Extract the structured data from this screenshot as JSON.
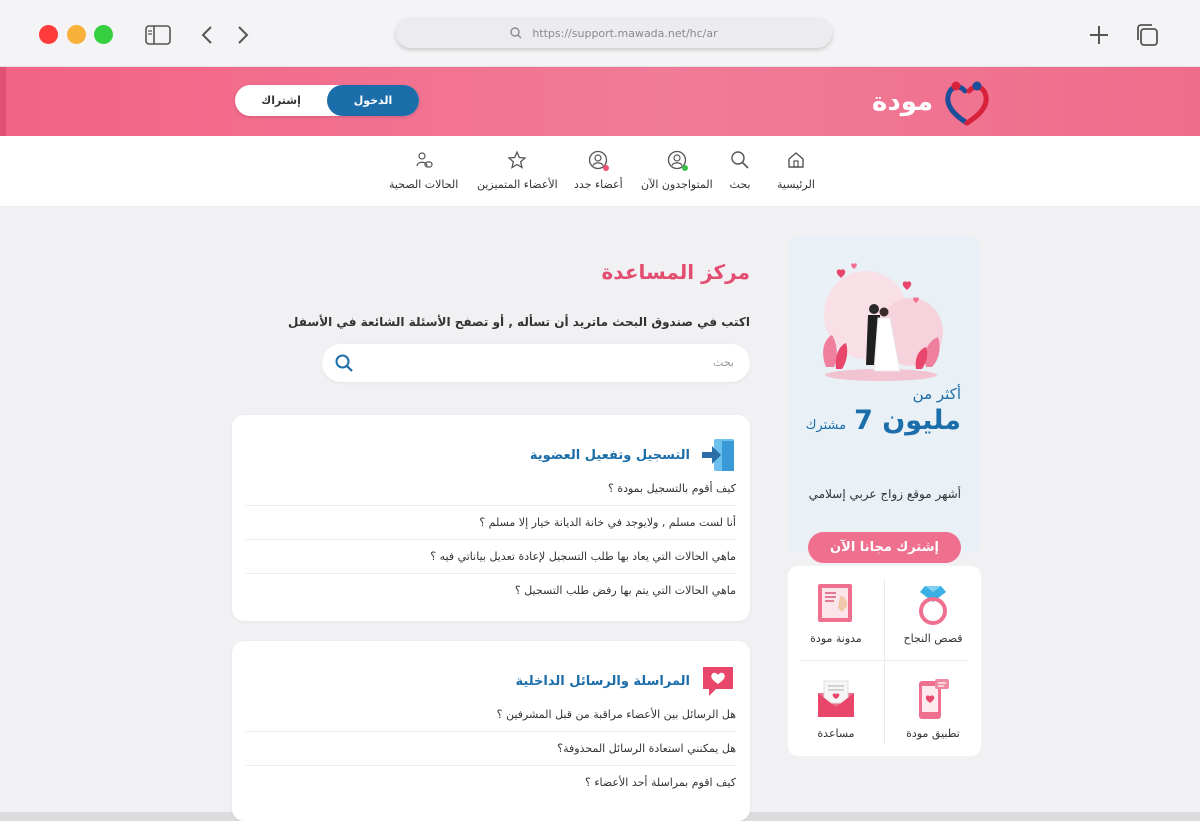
{
  "browser": {
    "url": "https://support.mawada.net/hc/ar"
  },
  "header": {
    "logo_text": "مودة",
    "login_label": "الدخول",
    "subscribe_label": "إشتراك"
  },
  "nav": {
    "items": [
      {
        "label": "الرئيسية",
        "icon": "home-icon"
      },
      {
        "label": "بحث",
        "icon": "search-icon"
      },
      {
        "label": "المتواجدون الآن",
        "icon": "user-online-icon"
      },
      {
        "label": "أعضاء جدد",
        "icon": "user-new-icon"
      },
      {
        "label": "الأعضاء المتميزين",
        "icon": "star-icon"
      },
      {
        "label": "الحالات الصحية",
        "icon": "health-icon"
      }
    ]
  },
  "main": {
    "title": "مركز المساعدة",
    "subtitle": "اكتب في صندوق البحث ماتريد أن تسأله , أو تصفح الأسئلة الشائعة في الأسفل",
    "search_placeholder": "بحث",
    "sections": [
      {
        "title": "التسجيل وتفعيل العضوية",
        "questions": [
          "كيف أقوم بالتسجيل بمودة ؟",
          "أنا لست مسلم , ولايوجد في خانة الديانة خيار إلا مسلم ؟",
          "ماهي الحالات التي يعاد بها طلب التسجيل لإعادة تعديل بياناتي فيه ؟",
          "ماهي الحالات التي يتم بها رفض طلب التسجيل ؟"
        ]
      },
      {
        "title": "المراسلة والرسائل الداخلية",
        "questions": [
          "هل الرسائل بين الأعضاء مراقبة من قبل المشرفين ؟",
          "هل يمكنني استعادة الرسائل المحذوفة؟",
          "كيف اقوم بمراسلة أحد الأعضاء ؟"
        ]
      }
    ]
  },
  "sidebar": {
    "promo": {
      "more_than": "أكثر من",
      "million": "7 مليون",
      "subscriber": "مشترك",
      "description": "أشهر موقع زواج عربي إسلامي",
      "cta": "إشترك مجانا الآن"
    },
    "links": [
      {
        "label": "قصص النجاح",
        "icon": "ring-icon"
      },
      {
        "label": "مدونة مودة",
        "icon": "blog-icon"
      },
      {
        "label": "تطبيق مودة",
        "icon": "phone-app-icon"
      },
      {
        "label": "مساعدة",
        "icon": "mail-help-icon"
      }
    ]
  },
  "colors": {
    "brand_pink": "#f26385",
    "brand_blue": "#1b6eaa",
    "title_pink": "#e34d70"
  }
}
